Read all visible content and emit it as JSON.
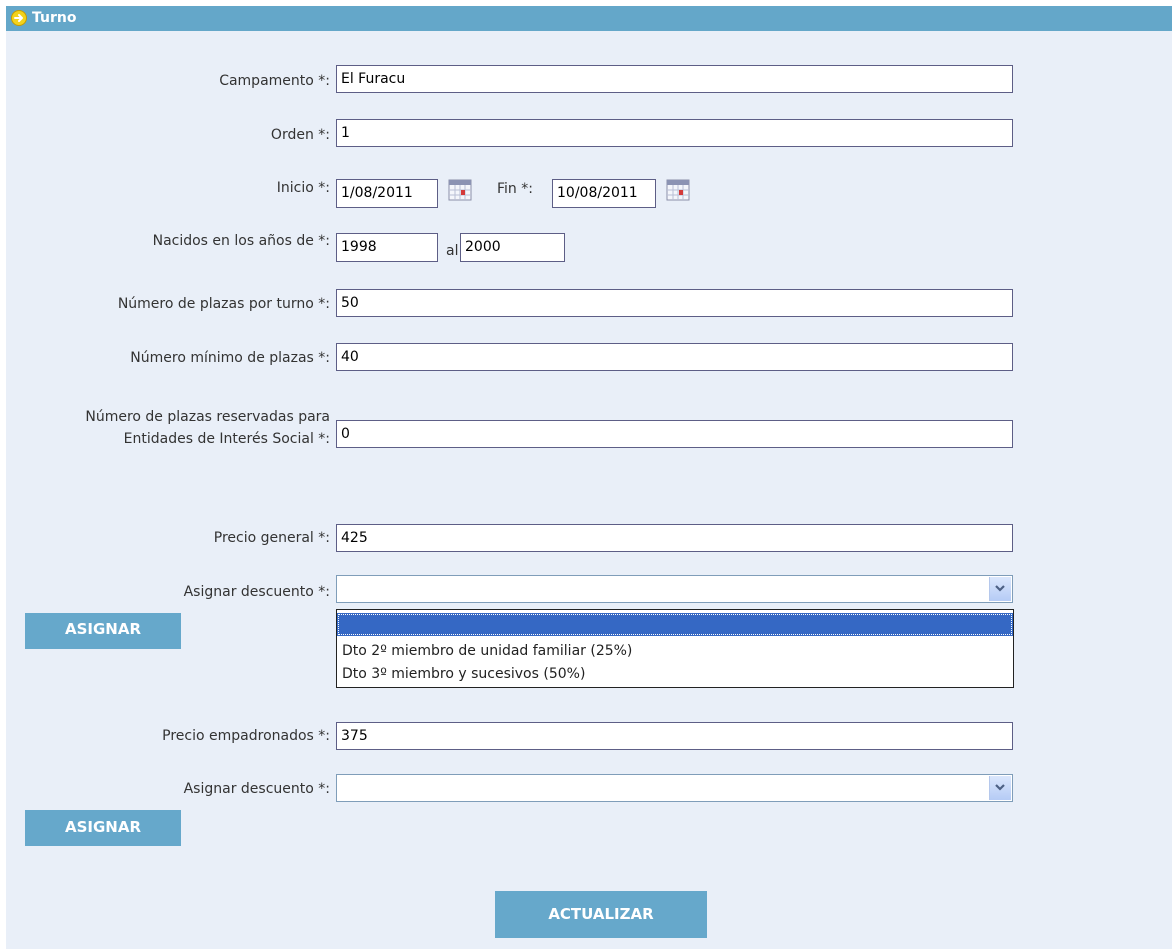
{
  "header": {
    "title": "Turno",
    "icon": "arrow-right-circle-icon"
  },
  "form": {
    "campamento": {
      "label": "Campamento *:",
      "value": "El Furacu"
    },
    "orden": {
      "label": "Orden *:",
      "value": "1"
    },
    "inicio": {
      "label": "Inicio *:",
      "value": "1/08/2011"
    },
    "fin": {
      "label": "Fin *:",
      "value": "10/08/2011"
    },
    "nacidos": {
      "label": "Nacidos en los años de *:",
      "from": "1998",
      "sep": "al",
      "to": "2000"
    },
    "plazas_turno": {
      "label": "Número de plazas por turno *:",
      "value": "50"
    },
    "plazas_minimo": {
      "label": "Número mínimo de plazas *:",
      "value": "40"
    },
    "plazas_reservadas": {
      "label_line1": "Número de plazas reservadas para",
      "label_line2": "Entidades de Interés Social *:",
      "value": "0"
    },
    "precio_general": {
      "label": "Precio general *:",
      "value": "425"
    },
    "descuento_general": {
      "label": "Asignar descuento *:",
      "selected": "",
      "options": [
        "",
        "Dto 2º miembro de unidad familiar (25%)",
        "Dto 3º miembro y sucesivos (50%)"
      ]
    },
    "asignar_1": "ASIGNAR",
    "precio_empadronados": {
      "label": "Precio empadronados *:",
      "value": "375"
    },
    "descuento_empadronados": {
      "label": "Asignar descuento *:",
      "selected": ""
    },
    "asignar_2": "ASIGNAR",
    "actualizar": "ACTUALIZAR"
  },
  "colors": {
    "header": "#64a7c9",
    "panel": "#e9eff8",
    "button": "#66a8cb",
    "selected_option": "#3568c4"
  }
}
